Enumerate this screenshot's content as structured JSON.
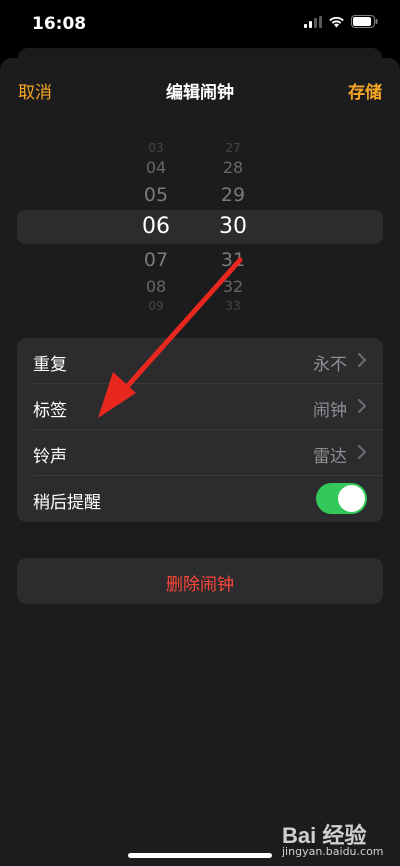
{
  "status_bar": {
    "time": "16:08"
  },
  "nav": {
    "cancel_label": "取消",
    "title": "编辑闹钟",
    "save_label": "存储"
  },
  "time_picker": {
    "hours": [
      "03",
      "04",
      "05",
      "06",
      "07",
      "08",
      "09"
    ],
    "minutes": [
      "27",
      "28",
      "29",
      "30",
      "31",
      "32",
      "33"
    ],
    "selected_hour": "06",
    "selected_minute": "30"
  },
  "settings": [
    {
      "label": "重复",
      "value": "永不"
    },
    {
      "label": "标签",
      "value": "闹钟"
    },
    {
      "label": "铃声",
      "value": "雷达"
    },
    {
      "label": "稍后提醒",
      "toggle_on": true
    }
  ],
  "delete_label": "删除闹钟",
  "watermark": {
    "logo_text": "Bai 经验",
    "url": "jingyan.baidu.com"
  },
  "colors": {
    "accent": "#f5a623",
    "danger": "#ff453a",
    "toggle_on": "#34c759",
    "annotation_arrow": "#e8281e"
  }
}
